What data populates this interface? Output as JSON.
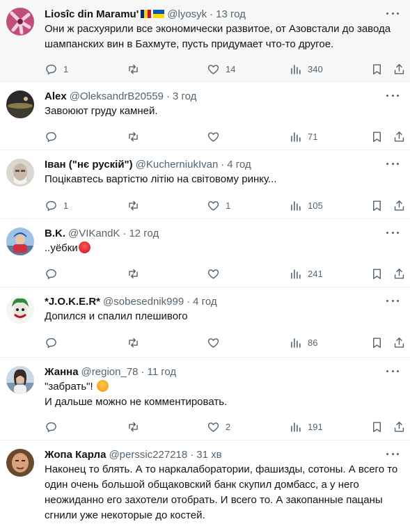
{
  "tweets": [
    {
      "name": "Liosîc din Maramu'",
      "handle": "@lyosyk",
      "time": "13 год",
      "text": "Они ж расхуярили все экономически развитое, от Азовстали до завода шампанских вин в Бахмуте, пусть придумает что-то другое.",
      "replies": "1",
      "retweets": "",
      "likes": "14",
      "views": "340"
    },
    {
      "name": "Alex",
      "handle": "@OleksandrB20559",
      "time": "3 год",
      "text": "Завоюют груду камней.",
      "replies": "",
      "retweets": "",
      "likes": "",
      "views": "71"
    },
    {
      "name": "Іван (\"нє рускій\")",
      "handle": "@KucherniukIvan",
      "time": "4 год",
      "text": "Поцікавтесь вартістю літію на світовому ринку...",
      "replies": "1",
      "retweets": "",
      "likes": "1",
      "views": "105"
    },
    {
      "name": "B.K.",
      "handle": "@VIKandK",
      "time": "12 год",
      "text": "..уёбки",
      "replies": "",
      "retweets": "",
      "likes": "",
      "views": "241"
    },
    {
      "name": "*J.O.K.E.R*",
      "handle": "@sobesednik999",
      "time": "4 год",
      "text": "Допился и спалил плешивого",
      "replies": "",
      "retweets": "",
      "likes": "",
      "views": "86"
    },
    {
      "name": "Жанна",
      "handle": "@region_78",
      "time": "11 год",
      "text_line1": "\"забрать\"!",
      "text_line2": "И дальше можно не комментировать.",
      "replies": "",
      "retweets": "",
      "likes": "2",
      "views": "191"
    },
    {
      "name": "Жопа Карла",
      "handle": "@perssic227218",
      "time": "31 хв",
      "text": "Наконец то блять. А то наркалаборатории, фашизды, сотоны. А всего то один очень большой общаковский банк скупил домбасс, а у него неожиданно его захотели отобрать. И всего то. А закопанные пацаны сгнили уже некоторые до костей."
    }
  ],
  "colors": {
    "text": "#0f1419",
    "secondary": "#536471",
    "divider": "#eff3f4",
    "highlight_bg": "#f7f7f7"
  },
  "icons": [
    "reply-icon",
    "retweet-icon",
    "like-icon",
    "views-icon",
    "bookmark-icon",
    "share-icon",
    "more-icon"
  ]
}
